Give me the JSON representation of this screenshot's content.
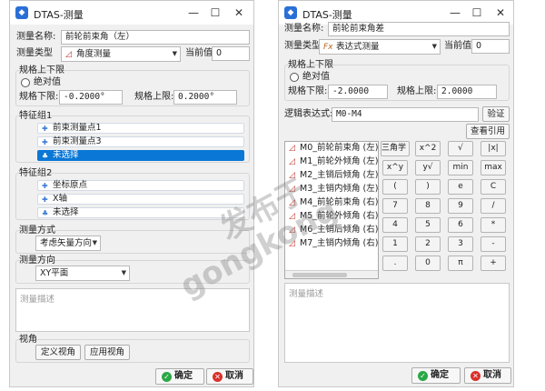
{
  "win1": {
    "title": "DTAS-测量",
    "minimize": "—",
    "maximize": "☐",
    "close": "✕",
    "name_label": "测量名称:",
    "name_value": "前轮前束角（左）",
    "type_label": "测量类型",
    "type_value": "角度测量",
    "current_label": "当前值",
    "current_value": "0",
    "limits_group": "规格上下限",
    "absolute_label": "绝对值",
    "lower_label": "规格下限:",
    "lower_value": "-0.2000°",
    "upper_label": "规格上限:",
    "upper_value": "0.2000°",
    "feature1_group": "特征组1",
    "feature1_items": [
      "前束测量点1",
      "前束测量点3",
      "未选择"
    ],
    "feature2_group": "特征组2",
    "feature2_items": [
      "坐标原点",
      "X轴",
      "未选择"
    ],
    "method_group": "测量方式",
    "method_value": "考虑矢量方向",
    "direction_group": "测量方向",
    "direction_value": "XY平面",
    "desc_placeholder": "测量描述",
    "view_group": "视角",
    "define_view": "定义视角",
    "apply_view": "应用视角",
    "ok": "确定",
    "cancel": "取消"
  },
  "win2": {
    "title": "DTAS-测量",
    "minimize": "—",
    "maximize": "☐",
    "close": "✕",
    "name_label": "测量名称:",
    "name_value": "前轮前束角差",
    "type_label": "测量类型",
    "type_value": "表达式测量",
    "current_label": "当前值",
    "current_value": "0",
    "limits_group": "规格上下限",
    "absolute_label": "绝对值",
    "lower_label": "规格下限:",
    "lower_value": "-2.0000",
    "upper_label": "规格上限:",
    "upper_value": "2.0000",
    "expr_label": "逻辑表达式:",
    "expr_value": "M0-M4",
    "verify": "验证",
    "view_refs": "查看引用",
    "measure_list": [
      "M0_前轮前束角 (左)",
      "M1_前轮外倾角 (左)",
      "M2_主销后倾角 (左)",
      "M3_主销内倾角 (左)",
      "M4_前轮前束角 (右)",
      "M5_前轮外倾角 (右)",
      "M6_主销后倾角 (右)",
      "M7_主销内倾角 (右)"
    ],
    "keys": [
      [
        "三角学 ▾",
        "x^2",
        "√",
        "|x|"
      ],
      [
        "x^y",
        "y√",
        "min",
        "max"
      ],
      [
        "(",
        ")",
        "e",
        "C"
      ],
      [
        "7",
        "8",
        "9",
        "/"
      ],
      [
        "4",
        "5",
        "6",
        "*"
      ],
      [
        "1",
        "2",
        "3",
        "-"
      ],
      [
        "",
        ".",
        "0",
        "π",
        "+"
      ]
    ],
    "desc_placeholder": "测量描述",
    "ok": "确定",
    "cancel": "取消"
  },
  "watermark": {
    "line1": "发布于",
    "line2": "gongkong"
  }
}
